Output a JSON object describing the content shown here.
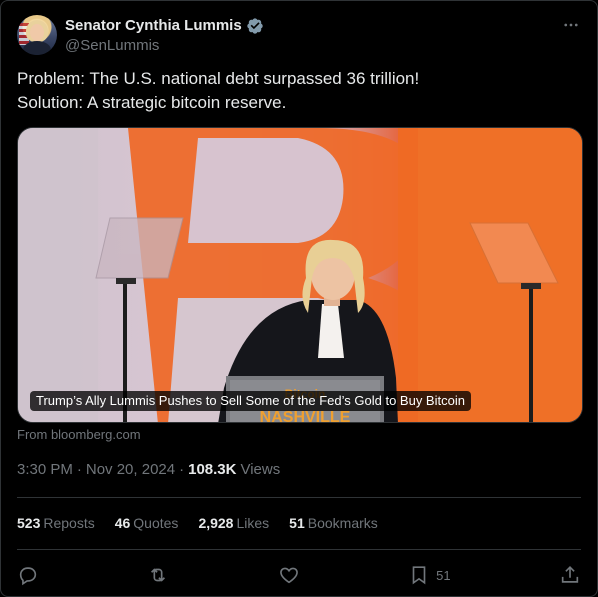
{
  "author": {
    "display_name": "Senator Cynthia Lummis",
    "handle": "@SenLummis",
    "verified_icon": "verified-badge-icon"
  },
  "tweet": {
    "line1": "Problem: The U.S. national debt surpassed 36 trillion!",
    "line2": "Solution: A strategic bitcoin reserve."
  },
  "link_card": {
    "caption": "Trump’s Ally Lummis Pushes to Sell Some of the Fed’s Gold to Buy Bitcoin",
    "source": "From bloomberg.com",
    "podium_text_top": "Bitcoin",
    "podium_text": "NASHVILLE"
  },
  "meta": {
    "time": "3:30 PM",
    "date": "Nov 20, 2024",
    "views_count": "108.3K",
    "views_label": "Views"
  },
  "stats": {
    "reposts_count": "523",
    "reposts_label": "Reposts",
    "quotes_count": "46",
    "quotes_label": "Quotes",
    "likes_count": "2,928",
    "likes_label": "Likes",
    "bookmarks_count": "51",
    "bookmarks_label": "Bookmarks"
  },
  "actions": {
    "bookmark_count": "51"
  },
  "colors": {
    "background": "#000000",
    "text": "#e7e9ea",
    "muted": "#71767b",
    "border": "#2f3336",
    "verified": "#829aab"
  }
}
